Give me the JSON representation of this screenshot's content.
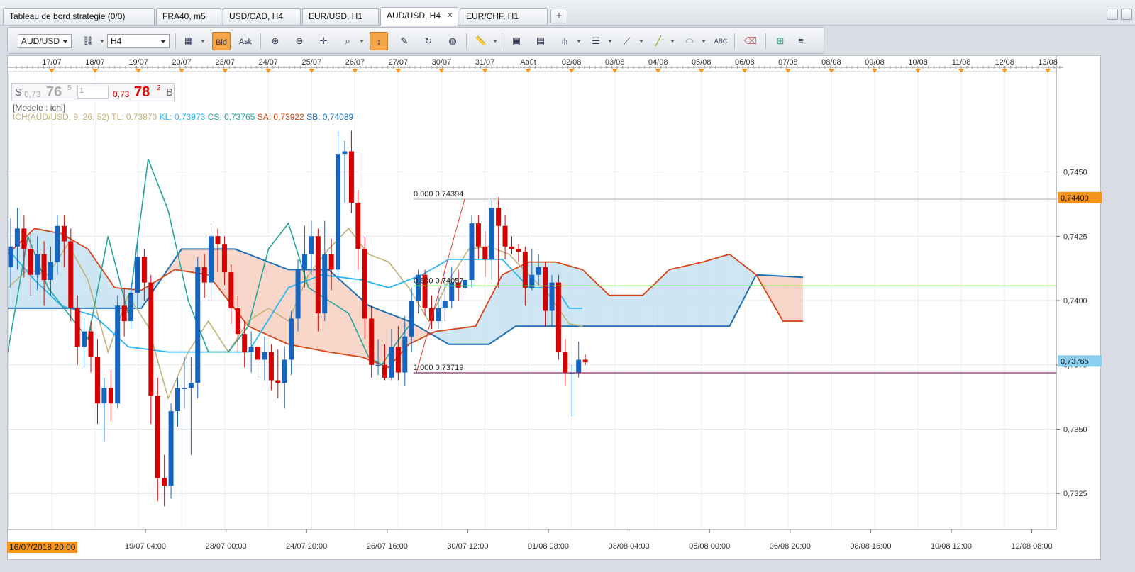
{
  "tabs": [
    {
      "label": "Tableau de bord strategie (0/0)",
      "active": false
    },
    {
      "label": "FRA40, m5",
      "active": false
    },
    {
      "label": "USD/CAD, H4",
      "active": false
    },
    {
      "label": "EUR/USD, H1",
      "active": false
    },
    {
      "label": "AUD/USD, H4",
      "active": true
    },
    {
      "label": "EUR/CHF, H1",
      "active": false
    }
  ],
  "tab_add": "+",
  "toolbar": {
    "symbol": "AUD/USD",
    "timeframe": "H4",
    "bid": "Bid",
    "ask": "Ask"
  },
  "quote": {
    "sell_letter": "S",
    "sell_prefix": "0,73",
    "sell_big": "76",
    "sell_sup": "5",
    "qty": "1",
    "buy_prefix": "0,73",
    "buy_big": "78",
    "buy_sup": "2",
    "buy_letter": "B"
  },
  "model_label": "[Modele : ichi]",
  "legend": {
    "ich": "ICH(AUD/USD, 9, 26, 52)",
    "tl": "TL: 0,73870",
    "kl": "KL: 0,73973",
    "cs": "CS: 0,73765",
    "sa": "SA: 0,73922",
    "sb": "SB: 0,74089"
  },
  "colors": {
    "bull": "#1565c0",
    "bear": "#d50000",
    "tenkan": "#c0b37a",
    "kijun": "#29b6f6",
    "chikou": "#26a69a",
    "senkou_a": "#d84315",
    "senkou_b": "#1e6fb5",
    "kumo_bull": "#c6e1f1",
    "kumo_bear": "#f7cfc0",
    "fib_mid": "#3be34a",
    "fib_low": "#8b2a6e",
    "price_badge": "#f7941d",
    "current_badge": "#89cff0"
  },
  "chart_data": {
    "type": "candlestick",
    "symbol": "AUD/USD",
    "timeframe": "H4",
    "y_range": [
      0.7311,
      0.7489
    ],
    "y_ticks": [
      "0,7450",
      "0,7425",
      "0,7400",
      "0,7375",
      "0,7350",
      "0,7325"
    ],
    "top_date_labels": [
      "17/07",
      "18/07",
      "19/07",
      "20/07",
      "23/07",
      "24/07",
      "25/07",
      "26/07",
      "27/07",
      "30/07",
      "31/07",
      "Août",
      "02/08",
      "03/08",
      "04/08",
      "05/08",
      "06/08",
      "07/08",
      "08/08",
      "09/08",
      "10/08",
      "11/08",
      "12/08",
      "13/08"
    ],
    "bottom_time_labels": [
      "19/07 04:00",
      "23/07 00:00",
      "24/07 20:00",
      "26/07 16:00",
      "30/07 12:00",
      "01/08 08:00",
      "03/08 04:00",
      "05/08 00:00",
      "06/08 20:00",
      "08/08 16:00",
      "10/08 12:00",
      "12/08 08:00"
    ],
    "crosshair_date": "16/07/2018 20:00",
    "price_badges": [
      {
        "label": "0,74400",
        "value": 0.744
      },
      {
        "label": "0,73765",
        "value": 0.73765
      }
    ],
    "fibonacci": [
      {
        "label": "0,000 0,74394",
        "value": 0.74394
      },
      {
        "label": "0,500 0,74057",
        "value": 0.74057
      },
      {
        "label": "1,000 0,73719",
        "value": 0.73719
      }
    ],
    "candles": [
      [
        0.7413,
        0.7421,
        0.7432,
        0.7405
      ],
      [
        0.7421,
        0.7428,
        0.7436,
        0.7412
      ],
      [
        0.7428,
        0.742,
        0.7433,
        0.7409
      ],
      [
        0.742,
        0.741,
        0.7427,
        0.7402
      ],
      [
        0.741,
        0.7418,
        0.7425,
        0.7404
      ],
      [
        0.7418,
        0.7408,
        0.7423,
        0.7398
      ],
      [
        0.7408,
        0.7415,
        0.7421,
        0.7402
      ],
      [
        0.7415,
        0.7429,
        0.7433,
        0.741
      ],
      [
        0.7429,
        0.7423,
        0.7433,
        0.7413
      ],
      [
        0.7423,
        0.7397,
        0.7428,
        0.7392
      ],
      [
        0.7397,
        0.7382,
        0.7402,
        0.7375
      ],
      [
        0.7382,
        0.7388,
        0.7393,
        0.7374
      ],
      [
        0.7388,
        0.7378,
        0.7392,
        0.7372
      ],
      [
        0.7378,
        0.736,
        0.7385,
        0.7352
      ],
      [
        0.736,
        0.7366,
        0.737,
        0.7345
      ],
      [
        0.7366,
        0.736,
        0.7373,
        0.7353
      ],
      [
        0.736,
        0.7398,
        0.7402,
        0.7358
      ],
      [
        0.7398,
        0.7392,
        0.7405,
        0.7386
      ],
      [
        0.7392,
        0.7403,
        0.7407,
        0.7389
      ],
      [
        0.7403,
        0.7417,
        0.7422,
        0.7397
      ],
      [
        0.7417,
        0.7407,
        0.742,
        0.74
      ],
      [
        0.7407,
        0.7363,
        0.741,
        0.7352
      ],
      [
        0.7363,
        0.7331,
        0.737,
        0.7322
      ],
      [
        0.7331,
        0.7328,
        0.734,
        0.732
      ],
      [
        0.7328,
        0.7357,
        0.736,
        0.7323
      ],
      [
        0.7357,
        0.7366,
        0.737,
        0.7351
      ],
      [
        0.7366,
        0.7366,
        0.7378,
        0.7358
      ],
      [
        0.7366,
        0.7368,
        0.7378,
        0.734
      ],
      [
        0.7368,
        0.7413,
        0.7417,
        0.7362
      ],
      [
        0.7413,
        0.7407,
        0.7418,
        0.7401
      ],
      [
        0.7407,
        0.7425,
        0.743,
        0.74
      ],
      [
        0.7425,
        0.7422,
        0.7428,
        0.7411
      ],
      [
        0.7422,
        0.7411,
        0.7425,
        0.7406
      ],
      [
        0.7411,
        0.7397,
        0.7414,
        0.7391
      ],
      [
        0.7397,
        0.7387,
        0.7402,
        0.738
      ],
      [
        0.7387,
        0.738,
        0.7392,
        0.7374
      ],
      [
        0.738,
        0.7382,
        0.7388,
        0.7372
      ],
      [
        0.7382,
        0.7377,
        0.7386,
        0.737
      ],
      [
        0.7377,
        0.738,
        0.7386,
        0.7369
      ],
      [
        0.738,
        0.7369,
        0.7383,
        0.7365
      ],
      [
        0.7369,
        0.7368,
        0.7381,
        0.7362
      ],
      [
        0.7368,
        0.7377,
        0.7382,
        0.7358
      ],
      [
        0.7377,
        0.7393,
        0.7396,
        0.7371
      ],
      [
        0.7393,
        0.7412,
        0.7416,
        0.7388
      ],
      [
        0.7412,
        0.7418,
        0.7429,
        0.7405
      ],
      [
        0.7418,
        0.7425,
        0.7431,
        0.741
      ],
      [
        0.7425,
        0.7395,
        0.7428,
        0.7388
      ],
      [
        0.7395,
        0.7418,
        0.7431,
        0.7392
      ],
      [
        0.7418,
        0.7412,
        0.7424,
        0.7404
      ],
      [
        0.7412,
        0.7457,
        0.7466,
        0.7408
      ],
      [
        0.7457,
        0.7458,
        0.7462,
        0.7438
      ],
      [
        0.7458,
        0.7438,
        0.7466,
        0.7434
      ],
      [
        0.7438,
        0.742,
        0.7443,
        0.7412
      ],
      [
        0.742,
        0.7393,
        0.7425,
        0.7385
      ],
      [
        0.7393,
        0.7375,
        0.7398,
        0.737
      ],
      [
        0.7375,
        0.7375,
        0.7385,
        0.7371
      ],
      [
        0.7375,
        0.737,
        0.7383,
        0.7369
      ],
      [
        0.737,
        0.7382,
        0.7389,
        0.7369
      ],
      [
        0.7382,
        0.7372,
        0.739,
        0.7369
      ],
      [
        0.7372,
        0.7386,
        0.7394,
        0.7367
      ],
      [
        0.7386,
        0.74,
        0.7405,
        0.738
      ],
      [
        0.74,
        0.741,
        0.7412,
        0.7395
      ],
      [
        0.741,
        0.7397,
        0.7412,
        0.7394
      ],
      [
        0.7397,
        0.7392,
        0.7402,
        0.7389
      ],
      [
        0.7392,
        0.7397,
        0.7405,
        0.7389
      ],
      [
        0.7397,
        0.74,
        0.7412,
        0.7392
      ],
      [
        0.74,
        0.7407,
        0.7413,
        0.7397
      ],
      [
        0.7407,
        0.7405,
        0.7412,
        0.74
      ],
      [
        0.7405,
        0.7408,
        0.7415,
        0.7403
      ],
      [
        0.7408,
        0.743,
        0.7433,
        0.7405
      ],
      [
        0.743,
        0.7421,
        0.7433,
        0.7416
      ],
      [
        0.7421,
        0.7416,
        0.7427,
        0.7409
      ],
      [
        0.7416,
        0.7436,
        0.7439,
        0.7408
      ],
      [
        0.7436,
        0.7429,
        0.744,
        0.7405
      ],
      [
        0.7429,
        0.7421,
        0.7433,
        0.7416
      ],
      [
        0.7421,
        0.742,
        0.7425,
        0.7418
      ],
      [
        0.742,
        0.7419,
        0.7422,
        0.7415
      ],
      [
        0.7419,
        0.7405,
        0.7421,
        0.7398
      ],
      [
        0.7405,
        0.741,
        0.742,
        0.7404
      ],
      [
        0.741,
        0.7413,
        0.7418,
        0.7406
      ],
      [
        0.7413,
        0.7396,
        0.7415,
        0.739
      ],
      [
        0.7396,
        0.7407,
        0.741,
        0.739
      ],
      [
        0.7407,
        0.738,
        0.741,
        0.7377
      ],
      [
        0.738,
        0.7372,
        0.7385,
        0.7367
      ],
      [
        0.7372,
        0.7372,
        0.7375,
        0.7355
      ],
      [
        0.7372,
        0.7377,
        0.7384,
        0.737
      ],
      [
        0.7377,
        0.7376,
        0.7379,
        0.7375
      ]
    ],
    "tenkan": [
      [
        0,
        0.7405
      ],
      [
        3,
        0.7412
      ],
      [
        6,
        0.741
      ],
      [
        9,
        0.7422
      ],
      [
        12,
        0.7408
      ],
      [
        15,
        0.738
      ],
      [
        18,
        0.7402
      ],
      [
        21,
        0.739
      ],
      [
        24,
        0.7362
      ],
      [
        27,
        0.738
      ],
      [
        30,
        0.7392
      ],
      [
        33,
        0.738
      ],
      [
        36,
        0.7392
      ],
      [
        39,
        0.7397
      ],
      [
        42,
        0.7392
      ],
      [
        45,
        0.741
      ],
      [
        48,
        0.742
      ],
      [
        51,
        0.7428
      ],
      [
        54,
        0.7418
      ],
      [
        57,
        0.7415
      ],
      [
        60,
        0.7405
      ],
      [
        63,
        0.7392
      ],
      [
        66,
        0.7408
      ],
      [
        69,
        0.742
      ],
      [
        72,
        0.7421
      ],
      [
        75,
        0.7418
      ],
      [
        78,
        0.741
      ],
      [
        81,
        0.7402
      ],
      [
        84,
        0.7391
      ],
      [
        86,
        0.739
      ]
    ],
    "kijun": [
      [
        0,
        0.742
      ],
      [
        4,
        0.7408
      ],
      [
        8,
        0.7398
      ],
      [
        13,
        0.7394
      ],
      [
        18,
        0.7382
      ],
      [
        24,
        0.738
      ],
      [
        30,
        0.738
      ],
      [
        36,
        0.738
      ],
      [
        42,
        0.7405
      ],
      [
        47,
        0.741
      ],
      [
        53,
        0.7408
      ],
      [
        57,
        0.7405
      ],
      [
        62,
        0.741
      ],
      [
        66,
        0.7416
      ],
      [
        70,
        0.7416
      ],
      [
        74,
        0.7416
      ],
      [
        78,
        0.7405
      ],
      [
        82,
        0.7405
      ],
      [
        84,
        0.7397
      ],
      [
        86,
        0.7397
      ]
    ],
    "chikou": [
      [
        0,
        0.738
      ],
      [
        3,
        0.7425
      ],
      [
        6,
        0.7405
      ],
      [
        9,
        0.7395
      ],
      [
        12,
        0.7385
      ],
      [
        15,
        0.7425
      ],
      [
        18,
        0.7395
      ],
      [
        21,
        0.7455
      ],
      [
        24,
        0.7435
      ],
      [
        27,
        0.74
      ],
      [
        30,
        0.738
      ],
      [
        33,
        0.738
      ],
      [
        36,
        0.739
      ],
      [
        39,
        0.742
      ],
      [
        42,
        0.743
      ],
      [
        45,
        0.7405
      ],
      [
        48,
        0.74
      ],
      [
        51,
        0.7395
      ],
      [
        54,
        0.7378
      ],
      [
        56,
        0.7375
      ],
      [
        58,
        0.7383
      ],
      [
        60,
        0.739
      ]
    ],
    "senkou_a": [
      [
        0,
        0.7418
      ],
      [
        4,
        0.7428
      ],
      [
        8,
        0.7426
      ],
      [
        12,
        0.742
      ],
      [
        16,
        0.7405
      ],
      [
        20,
        0.7404
      ],
      [
        25,
        0.7412
      ],
      [
        30,
        0.741
      ],
      [
        36,
        0.739
      ],
      [
        42,
        0.7383
      ],
      [
        48,
        0.738
      ],
      [
        53,
        0.7378
      ],
      [
        57,
        0.7374
      ],
      [
        60,
        0.7383
      ],
      [
        64,
        0.7388
      ],
      [
        70,
        0.739
      ],
      [
        74,
        0.741
      ],
      [
        78,
        0.7415
      ],
      [
        82,
        0.7415
      ],
      [
        86,
        0.7412
      ],
      [
        90,
        0.7402
      ],
      [
        95,
        0.7402
      ],
      [
        99,
        0.7412
      ],
      [
        104,
        0.7415
      ],
      [
        108,
        0.7418
      ],
      [
        112,
        0.741
      ],
      [
        116,
        0.7392
      ],
      [
        119,
        0.7392
      ]
    ],
    "senkou_b": [
      [
        0,
        0.7397
      ],
      [
        8,
        0.7397
      ],
      [
        14,
        0.7397
      ],
      [
        20,
        0.7397
      ],
      [
        26,
        0.742
      ],
      [
        34,
        0.742
      ],
      [
        42,
        0.7412
      ],
      [
        48,
        0.7412
      ],
      [
        54,
        0.7398
      ],
      [
        60,
        0.7392
      ],
      [
        66,
        0.7383
      ],
      [
        72,
        0.7383
      ],
      [
        76,
        0.739
      ],
      [
        82,
        0.739
      ],
      [
        88,
        0.739
      ],
      [
        95,
        0.739
      ],
      [
        102,
        0.739
      ],
      [
        108,
        0.739
      ],
      [
        112,
        0.741
      ],
      [
        119,
        0.7409
      ]
    ]
  }
}
